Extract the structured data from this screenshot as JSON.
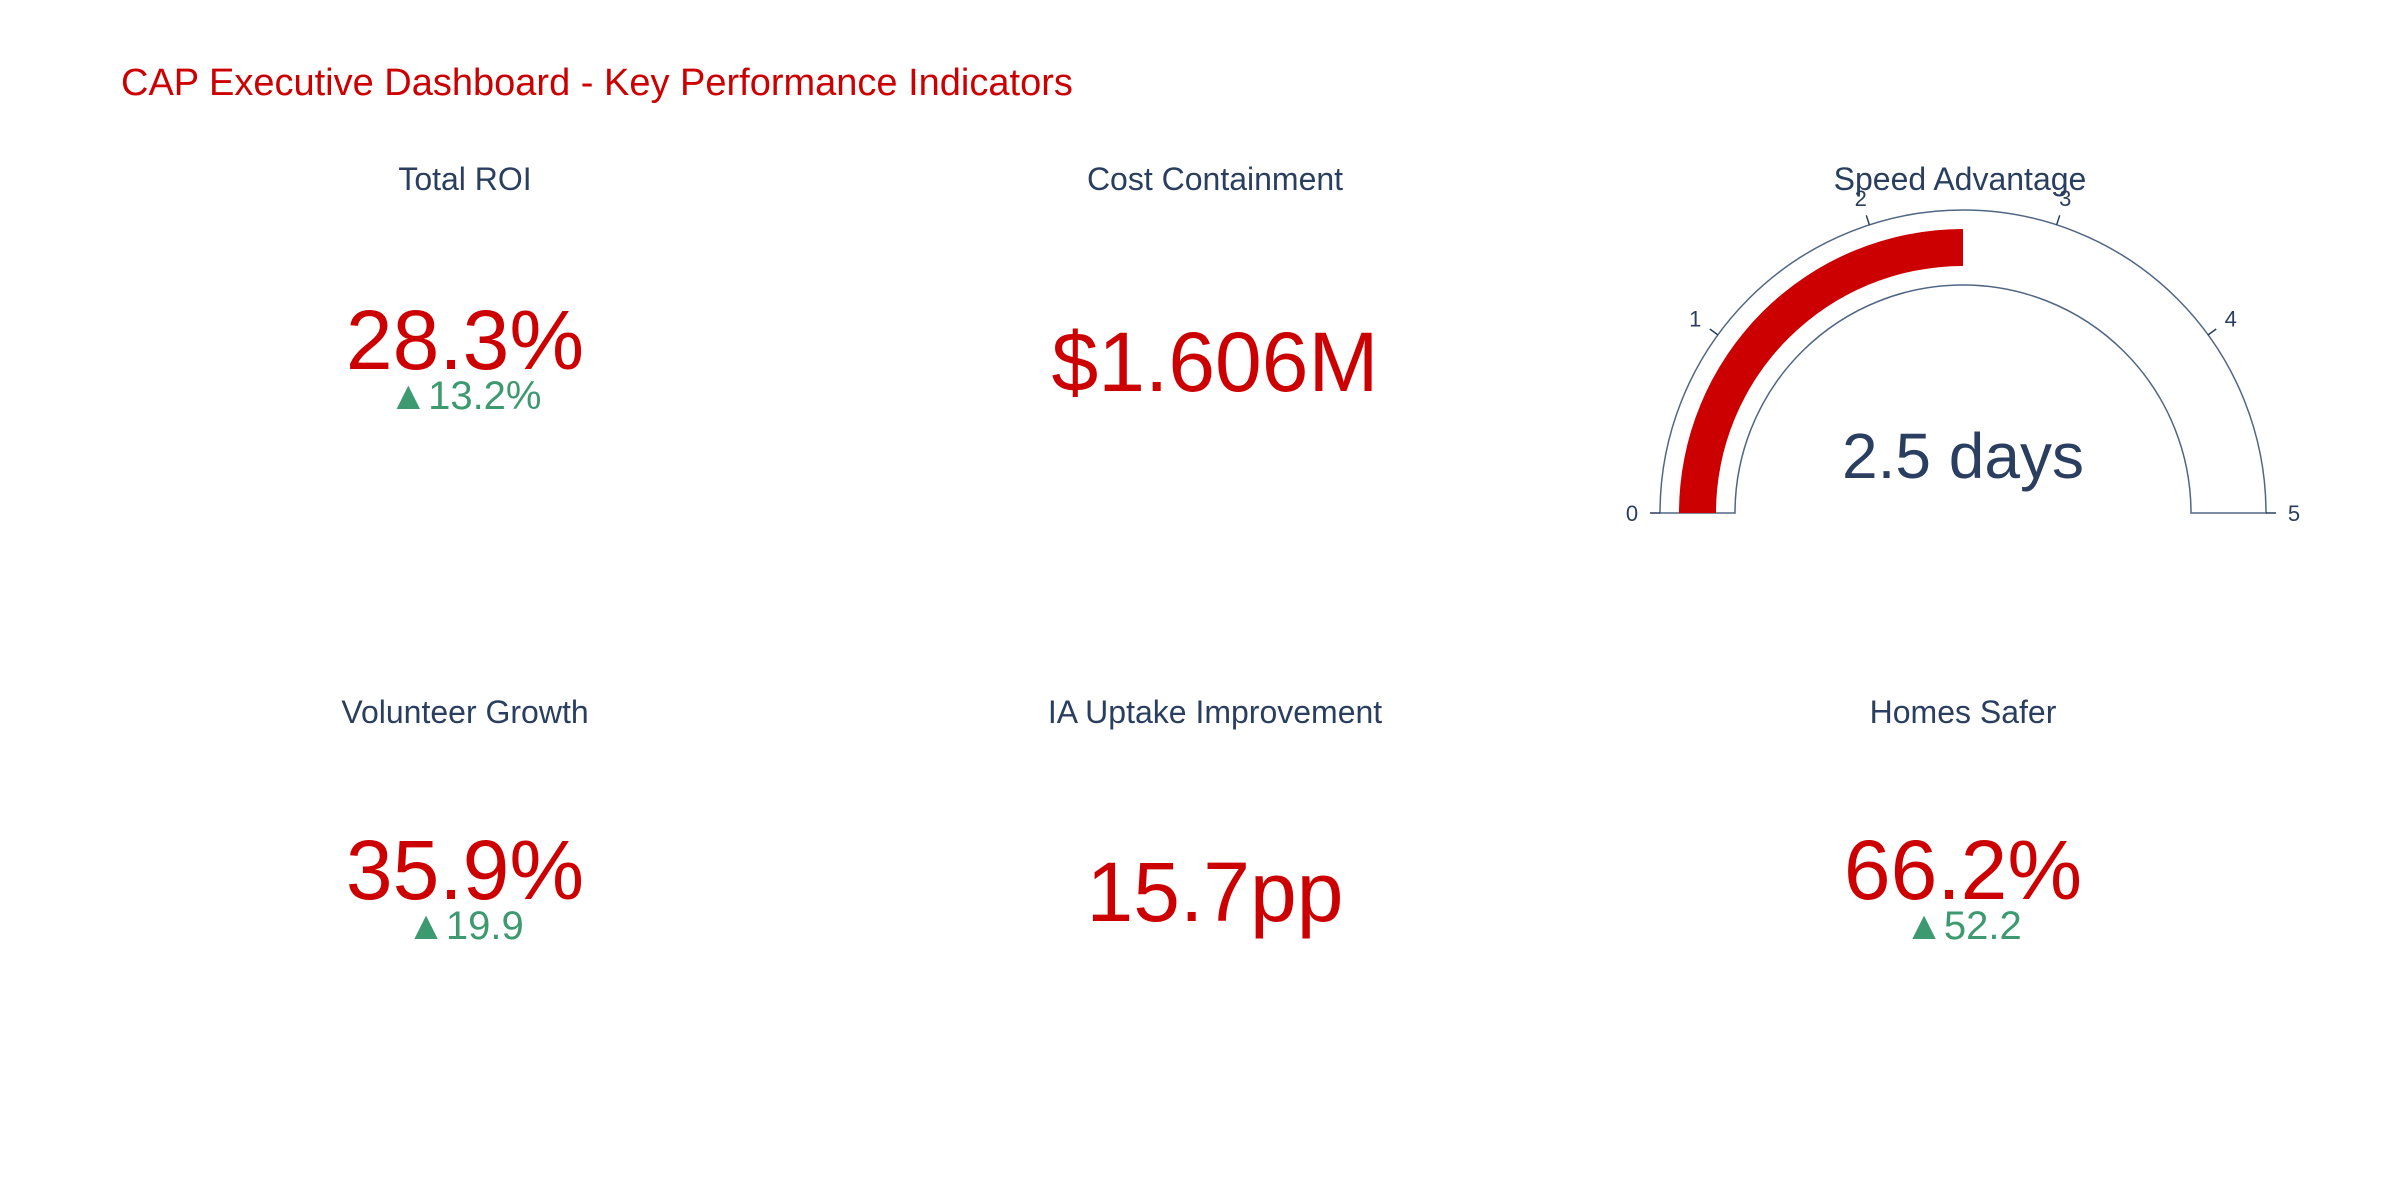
{
  "title": "CAP Executive Dashboard - Key Performance Indicators",
  "colors": {
    "value": "#cc0000",
    "title": "#2a3f5f",
    "delta_up": "#3d9970",
    "gauge_bar": "#cc0000",
    "gauge_border": "#506784"
  },
  "chart_data": [
    {
      "type": "indicator",
      "title": "Total ROI",
      "value": 28.3,
      "value_text": "28.3%",
      "delta": 13.2,
      "delta_text": "13.2%",
      "delta_direction": "up",
      "delta_symbol": "▲"
    },
    {
      "type": "indicator",
      "title": "Cost Containment",
      "value": 1.606,
      "value_text": "$1.606M"
    },
    {
      "type": "gauge",
      "title": "Speed Advantage",
      "value": 2.5,
      "value_text": "2.5 days",
      "range": [
        0,
        5
      ],
      "ticks": [
        "0",
        "1",
        "2",
        "3",
        "4",
        "5"
      ]
    },
    {
      "type": "indicator",
      "title": "Volunteer Growth",
      "value": 35.9,
      "value_text": "35.9%",
      "delta": 19.9,
      "delta_text": "19.9",
      "delta_direction": "up",
      "delta_symbol": "▲"
    },
    {
      "type": "indicator",
      "title": "IA Uptake Improvement",
      "value": 15.7,
      "value_text": "15.7pp"
    },
    {
      "type": "indicator",
      "title": "Homes Safer",
      "value": 66.2,
      "value_text": "66.2%",
      "delta": 52.2,
      "delta_text": "52.2",
      "delta_direction": "up",
      "delta_symbol": "▲"
    }
  ]
}
